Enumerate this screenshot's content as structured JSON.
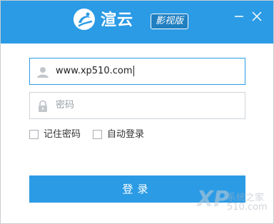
{
  "header": {
    "brand_name": "渲云",
    "edition_badge": "影视版",
    "background_color": "#2b9be5"
  },
  "window_controls": {
    "minimize_icon": "minimize-icon",
    "close_icon": "close-icon"
  },
  "login_form": {
    "username": {
      "value": "www.xp510.com",
      "icon": "user-icon"
    },
    "password": {
      "placeholder": "密码",
      "icon": "lock-icon"
    },
    "remember_password_label": "记住密码",
    "auto_login_label": "自动登录",
    "login_button_label": "登录",
    "accent_color": "#2b9be5"
  },
  "watermark": {
    "top_text": "系统之家",
    "bottom_text": "510.com"
  }
}
